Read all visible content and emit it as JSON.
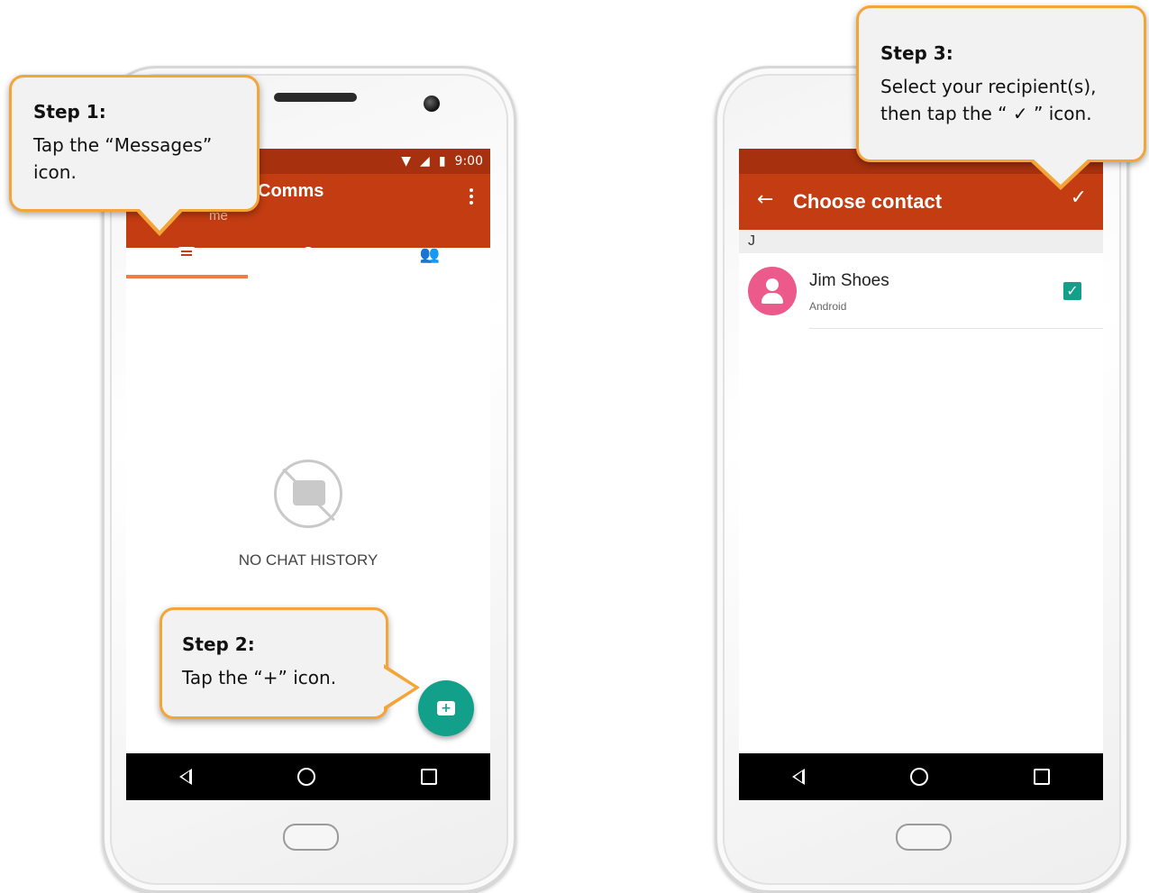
{
  "colors": {
    "accent": "#c43c12",
    "status_bar": "#a7310e",
    "fab": "#12a08a",
    "callout_border": "#f4a53a",
    "avatar": "#ec5a8b"
  },
  "left_phone": {
    "status_time": "9:00",
    "app_title": "Comms",
    "app_subtitle": "me",
    "tabs": [
      {
        "icon": "chat-bubble-icon",
        "active": true
      },
      {
        "icon": "clock-icon",
        "active": false
      },
      {
        "icon": "contacts-icon",
        "active": false
      }
    ],
    "empty_state_text": "NO CHAT HISTORY",
    "fab_icon": "new-message-icon"
  },
  "right_phone": {
    "title": "Choose contact",
    "section_letter": "J",
    "contact": {
      "name": "Jim Shoes",
      "type": "Android",
      "checked": true
    }
  },
  "callouts": {
    "step1": {
      "title": "Step 1:",
      "body": "Tap the “Messages” icon."
    },
    "step2": {
      "title": "Step 2:",
      "body": "Tap the “+” icon."
    },
    "step3": {
      "title": "Step 3:",
      "body": "Select your recipient(s), then tap the “ ✓ ” icon."
    }
  }
}
